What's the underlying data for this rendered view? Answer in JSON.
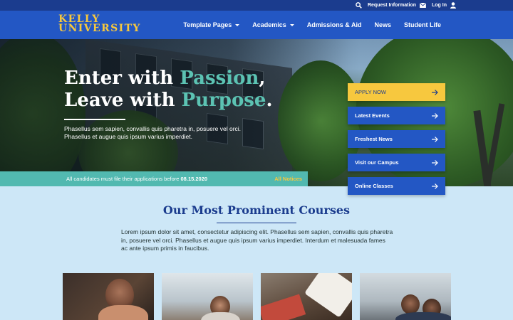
{
  "utility": {
    "search_icon": "search-icon",
    "request_info": "Request Information",
    "login": "Log In"
  },
  "header": {
    "logo_line1": "KELLY",
    "logo_line2": "UNIVERSITY",
    "nav": [
      "Template Pages",
      "Academics",
      "Admissions & Aid",
      "News",
      "Student Life"
    ]
  },
  "hero": {
    "title_part1": "Enter with ",
    "title_accent1": "Passion",
    "title_part2": ",",
    "title_part3": "Leave with ",
    "title_accent2": "Purpose",
    "title_part4": ".",
    "subtitle": "Phasellus sem sapien, convallis quis pharetra in, posuere vel orci. Phasellus et augue quis ipsum varius imperdiet."
  },
  "notice": {
    "text": "All candidates must file their applications before ",
    "date": "08.15.2020",
    "link": "All Notices"
  },
  "quick_links": [
    "APPLY NOW",
    "Latest Events",
    "Freshest News",
    "Visit our Campus",
    "Online Classes"
  ],
  "courses": {
    "title": "Our Most Prominent Courses",
    "body": "Lorem ipsum dolor sit amet, consectetur adipiscing elit. Phasellus sem sapien, convallis quis pharetra in, posuere vel orci. Phasellus et augue quis ipsum varius imperdiet. Interdum et malesuada fames ac ante ipsum primis in faucibus."
  },
  "colors": {
    "brand_blue": "#2357c4",
    "dark_blue": "#1b3c8e",
    "accent_gold": "#f7c83e",
    "accent_teal": "#5cc3b3"
  }
}
